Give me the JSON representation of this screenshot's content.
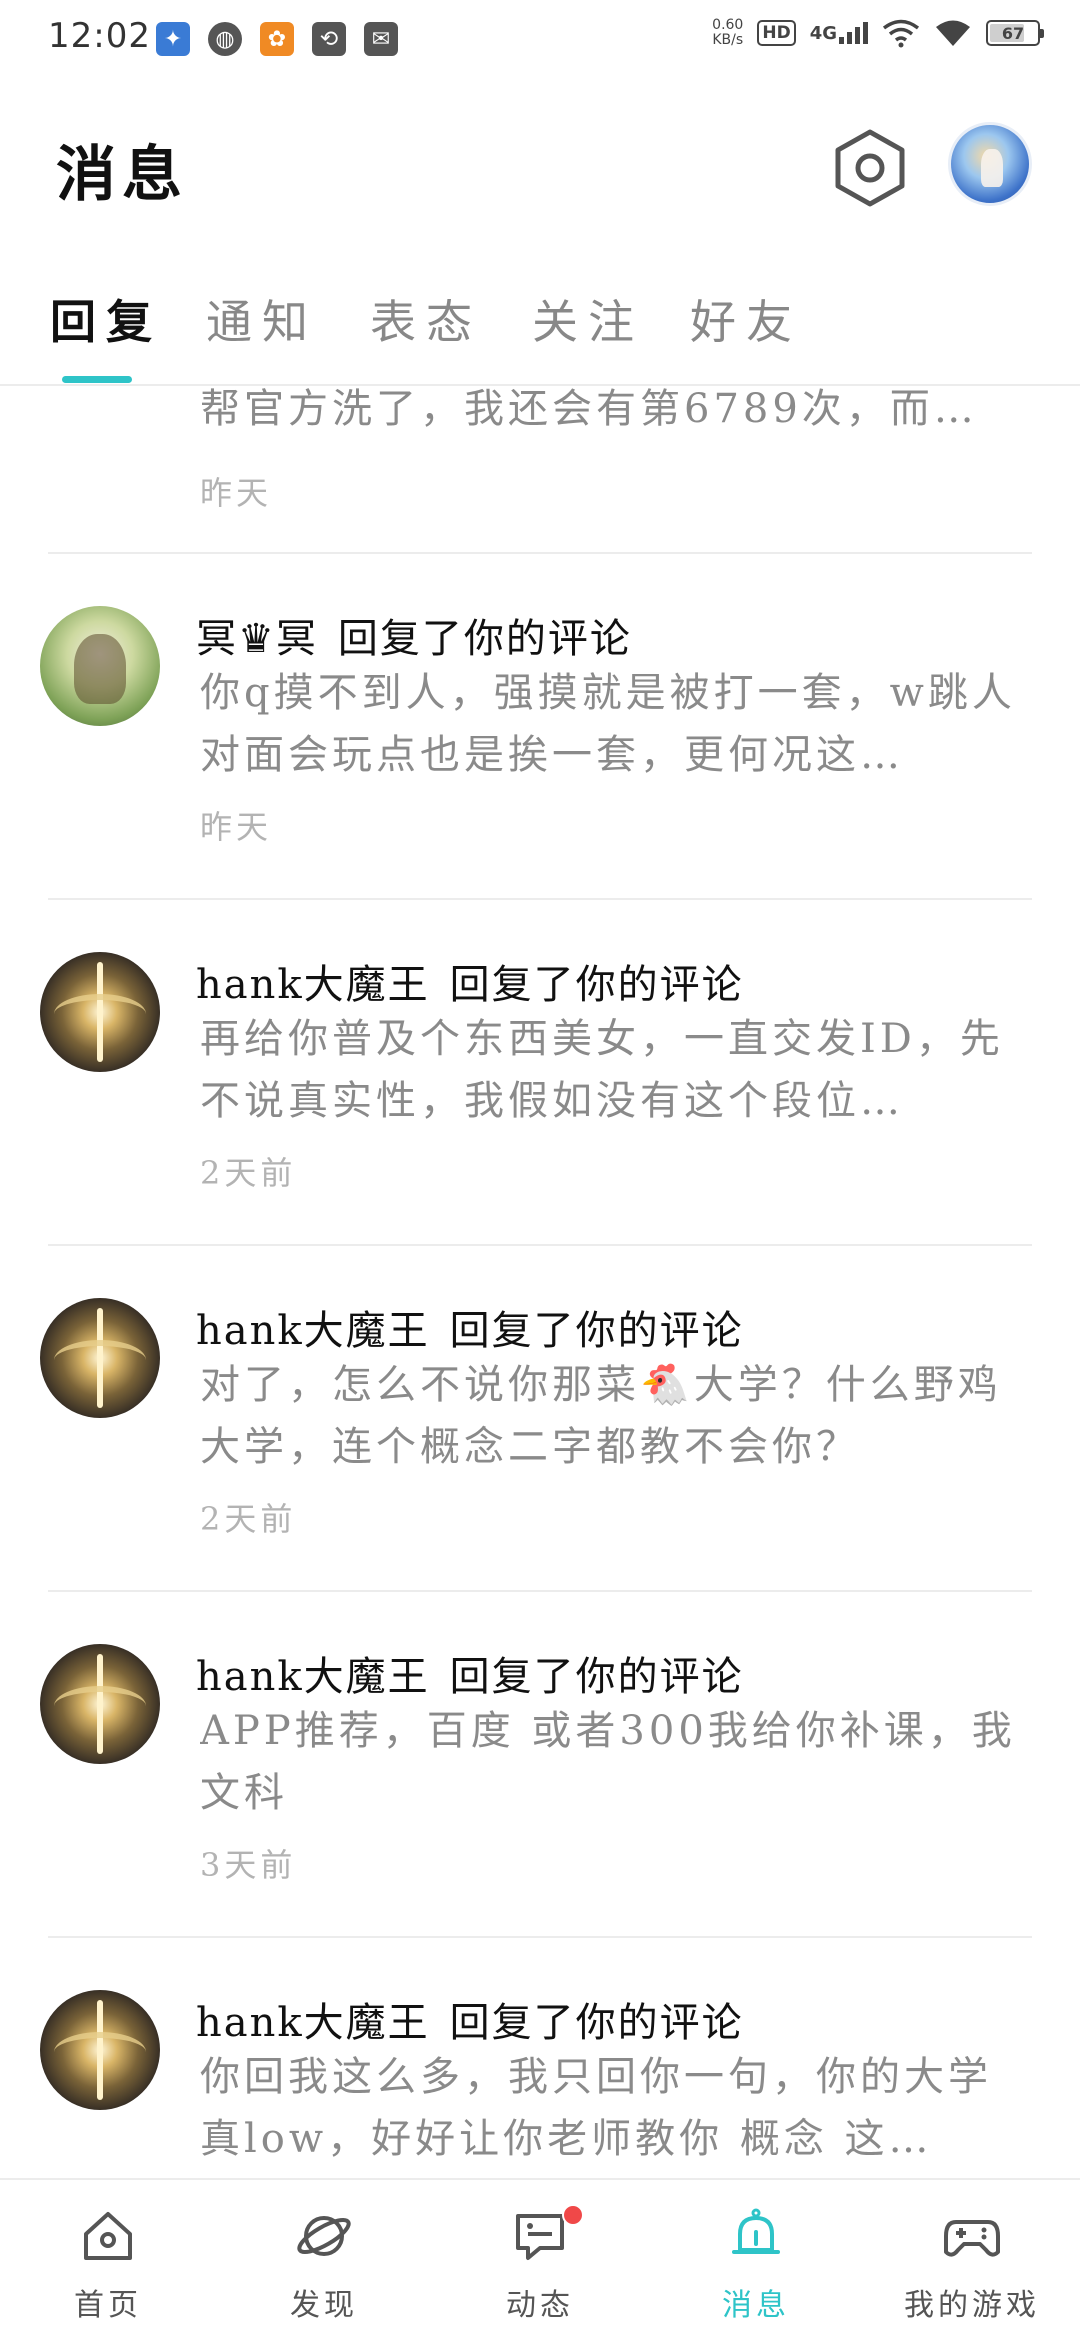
{
  "status_bar": {
    "time": "12:02",
    "net_speed_value": "0.60",
    "net_speed_unit": "KB/s",
    "hd_label": "HD",
    "network_type": "4G",
    "battery_level": "67"
  },
  "header": {
    "title": "消息"
  },
  "tabs": [
    {
      "label": "回复",
      "active": true
    },
    {
      "label": "通知",
      "active": false
    },
    {
      "label": "表态",
      "active": false
    },
    {
      "label": "关注",
      "active": false
    },
    {
      "label": "好友",
      "active": false
    }
  ],
  "messages": {
    "partial": {
      "body": "帮官方洗了，我还会有第6789次，而…",
      "time": "昨天"
    },
    "items": [
      {
        "name": "冥♛冥",
        "action": "回复了你的评论",
        "body": "你q摸不到人，强摸就是被打一套，w跳人对面会玩点也是挨一套，更何况这…",
        "time": "昨天"
      },
      {
        "name": "hank大魔王",
        "action": "回复了你的评论",
        "body": "再给你普及个东西美女，一直交发ID，先不说真实性，我假如没有这个段位…",
        "time": "2天前"
      },
      {
        "name": "hank大魔王",
        "action": "回复了你的评论",
        "body": "对了，怎么不说你那菜🐔大学？什么野鸡大学，连个概念二字都教不会你？",
        "time": "2天前"
      },
      {
        "name": "hank大魔王",
        "action": "回复了你的评论",
        "body": "APP推荐，百度 或者300我给你补课，我文科",
        "time": "3天前"
      },
      {
        "name": "hank大魔王",
        "action": "回复了你的评论",
        "body": "你回我这么多，我只回你一句，你的大学真low，好好让你老师教你 概念 这…",
        "time": ""
      }
    ]
  },
  "bottom_nav": [
    {
      "label": "首页",
      "icon": "home-icon",
      "active": false
    },
    {
      "label": "发现",
      "icon": "planet-icon",
      "active": false
    },
    {
      "label": "动态",
      "icon": "chat-icon",
      "active": false,
      "has_badge": true
    },
    {
      "label": "消息",
      "icon": "bell-icon",
      "active": true
    },
    {
      "label": "我的游戏",
      "icon": "gamepad-icon",
      "active": false
    }
  ],
  "colors": {
    "accent": "#2ec4c8",
    "badge": "#f04848",
    "secondary_text": "#8a8a8a",
    "time_text": "#b3b3b3"
  }
}
